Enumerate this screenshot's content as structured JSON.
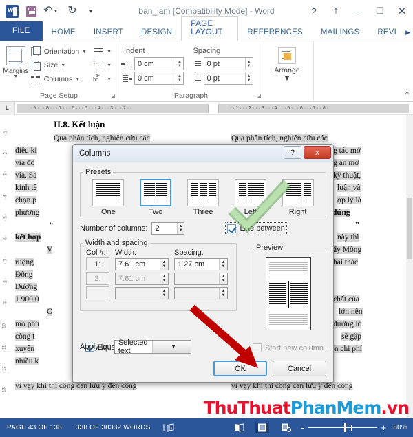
{
  "window": {
    "title": "ban_lam [Compatibility Mode] - Word",
    "quick_access": [
      "word-icon",
      "save-icon",
      "undo-icon",
      "redo-icon",
      "customize-qat-icon"
    ],
    "help_label": "?",
    "ribbon_display_label": "⤒",
    "minimize_label": "—",
    "maximize_label": "❑",
    "close_label": "✕"
  },
  "tabs": [
    {
      "label": "FILE",
      "active": false,
      "file": true
    },
    {
      "label": "HOME",
      "active": false
    },
    {
      "label": "INSERT",
      "active": false
    },
    {
      "label": "DESIGN",
      "active": false
    },
    {
      "label": "PAGE LAYOUT",
      "active": true
    },
    {
      "label": "REFERENCES",
      "active": false
    },
    {
      "label": "MAILINGS",
      "active": false
    },
    {
      "label": "REVI",
      "active": false
    }
  ],
  "ribbon": {
    "page_setup": {
      "group_title": "Page Setup",
      "margins_label": "Margins",
      "orientation_label": "Orientation",
      "size_label": "Size",
      "columns_label": "Columns",
      "breaks_label": "",
      "line_numbers_label": "",
      "hyphenation_label": ""
    },
    "paragraph": {
      "group_title": "Paragraph",
      "indent_label": "Indent",
      "spacing_label": "Spacing",
      "indent_left": "0 cm",
      "indent_right": "0 cm",
      "spacing_before": "0 pt",
      "spacing_after": "0 pt"
    },
    "arrange": {
      "group_title": "",
      "label": "Arrange"
    }
  },
  "ruler": {
    "tab_selector": "L",
    "left_ticks": [
      "9",
      "8",
      "7",
      "6",
      "5",
      "4",
      "3",
      "2"
    ],
    "right_ticks": [
      "1",
      "2",
      "3",
      "4",
      "5",
      "6",
      "7",
      "8"
    ],
    "vertical_ticks": [
      "1",
      "2",
      "3",
      "4",
      "5",
      "6",
      "7",
      "8",
      "9",
      "10",
      "11",
      "12",
      "13"
    ]
  },
  "document": {
    "heading": "II.8. Kết luận",
    "left_column": [
      "Qua phân tích, nghiên cứu các",
      "điều ki",
      "vỉa đố",
      "vỉa. Sa",
      "kinh tế",
      "chọn p",
      "phương",
      "“",
      "kết hợp",
      "V",
      "ruộng",
      "Đông",
      "Dương",
      "1.900.0",
      "C",
      "mỏ phủ",
      "công t",
      "xuyên",
      "nhiều k",
      "vì vậy khi thi công cần lưu ý đến công"
    ],
    "right_column": [
      "Qua phân tích, nghiên cứu các",
      "g tác mở",
      "g án mở",
      "kỹ thuật,",
      "luận và",
      "ợp lý là",
      "ng đứng",
      "”",
      "này thì",
      "ấy Mông",
      "hai thác",
      "chất của",
      "lớn nên",
      "đường lò",
      "sẽ gặp",
      "ổn chi phí",
      "vì vậy khi thi công cần lưu ý đến công"
    ]
  },
  "dialog": {
    "title": "Columns",
    "help_btn": "?",
    "close_btn": "x",
    "presets": {
      "legend": "Presets",
      "items": [
        {
          "label": "One",
          "accel": "O",
          "selected": false,
          "cols": 1
        },
        {
          "label": "Two",
          "accel": "T",
          "selected": true,
          "cols": 2
        },
        {
          "label": "Three",
          "accel": "T",
          "selected": false,
          "cols": 3
        },
        {
          "label": "Left",
          "accel": "L",
          "selected": false,
          "cols": 2
        },
        {
          "label": "Right",
          "accel": "R",
          "selected": false,
          "cols": 2
        }
      ]
    },
    "number_of_columns_label": "Number of columns:",
    "number_of_columns_value": "2",
    "line_between_label": "Line between",
    "line_between_checked": true,
    "width_spacing": {
      "legend": "Width and spacing",
      "col_header": "Col #:",
      "width_header": "Width:",
      "spacing_header": "Spacing:",
      "rows": [
        {
          "col": "1:",
          "width": "7.61 cm",
          "spacing": "1.27 cm",
          "enabled": true
        },
        {
          "col": "2:",
          "width": "7.61 cm",
          "spacing": "",
          "enabled": false
        },
        {
          "col": "",
          "width": "",
          "spacing": "",
          "enabled": false
        }
      ]
    },
    "equal_column_width_label": "Equal column width",
    "equal_column_width_checked": true,
    "preview_legend": "Preview",
    "apply_to_label": "Apply to:",
    "apply_to_value": "Selected text",
    "start_new_column_label": "Start new column",
    "start_new_column_checked": false,
    "ok_label": "OK",
    "cancel_label": "Cancel"
  },
  "status_bar": {
    "page": "PAGE 43 OF 138",
    "words": "338 OF 38332 WORDS",
    "proofing_icon": "spelling-check-icon",
    "views": [
      "read-mode-icon",
      "print-layout-icon",
      "web-layout-icon"
    ],
    "zoom_out": "-",
    "zoom_in": "+",
    "zoom_level": "80%"
  },
  "watermark": {
    "part1": "ThuThuat",
    "part2": "PhanMem",
    "part3": ".vn"
  },
  "colors": {
    "word_blue": "#2b579a",
    "accent_blue": "#4a9ad4",
    "close_red": "#c03a22",
    "watermark_red": "#e8112d",
    "watermark_blue": "#1d9ad6",
    "arrow_red": "#c00000",
    "check_green": "#a8d8a0"
  }
}
